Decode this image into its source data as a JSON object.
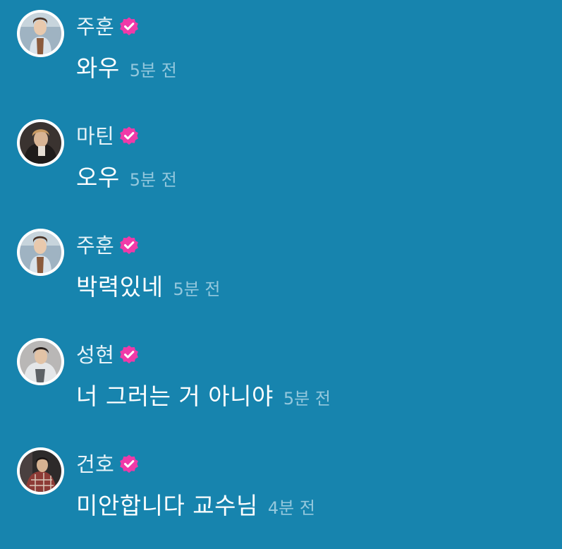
{
  "colors": {
    "background": "#1784ae",
    "name_text": "#e7f3f8",
    "message_text": "#ffffff",
    "timestamp_text": "#94c8dd",
    "verified_badge": "#f03aa8"
  },
  "comments": [
    {
      "name": "주훈",
      "text": "와우",
      "time": "5분 전",
      "badge_icon": "verified-icon",
      "avatar_icon": "user-avatar"
    },
    {
      "name": "마틴",
      "text": "오우",
      "time": "5분 전",
      "badge_icon": "verified-icon",
      "avatar_icon": "user-avatar"
    },
    {
      "name": "주훈",
      "text": "박력있네",
      "time": "5분 전",
      "badge_icon": "verified-icon",
      "avatar_icon": "user-avatar"
    },
    {
      "name": "성현",
      "text": "너 그러는 거 아니야",
      "time": "5분 전",
      "badge_icon": "verified-icon",
      "avatar_icon": "user-avatar"
    },
    {
      "name": "건호",
      "text": "미안합니다 교수님",
      "time": "4분 전",
      "badge_icon": "verified-icon",
      "avatar_icon": "user-avatar"
    }
  ]
}
